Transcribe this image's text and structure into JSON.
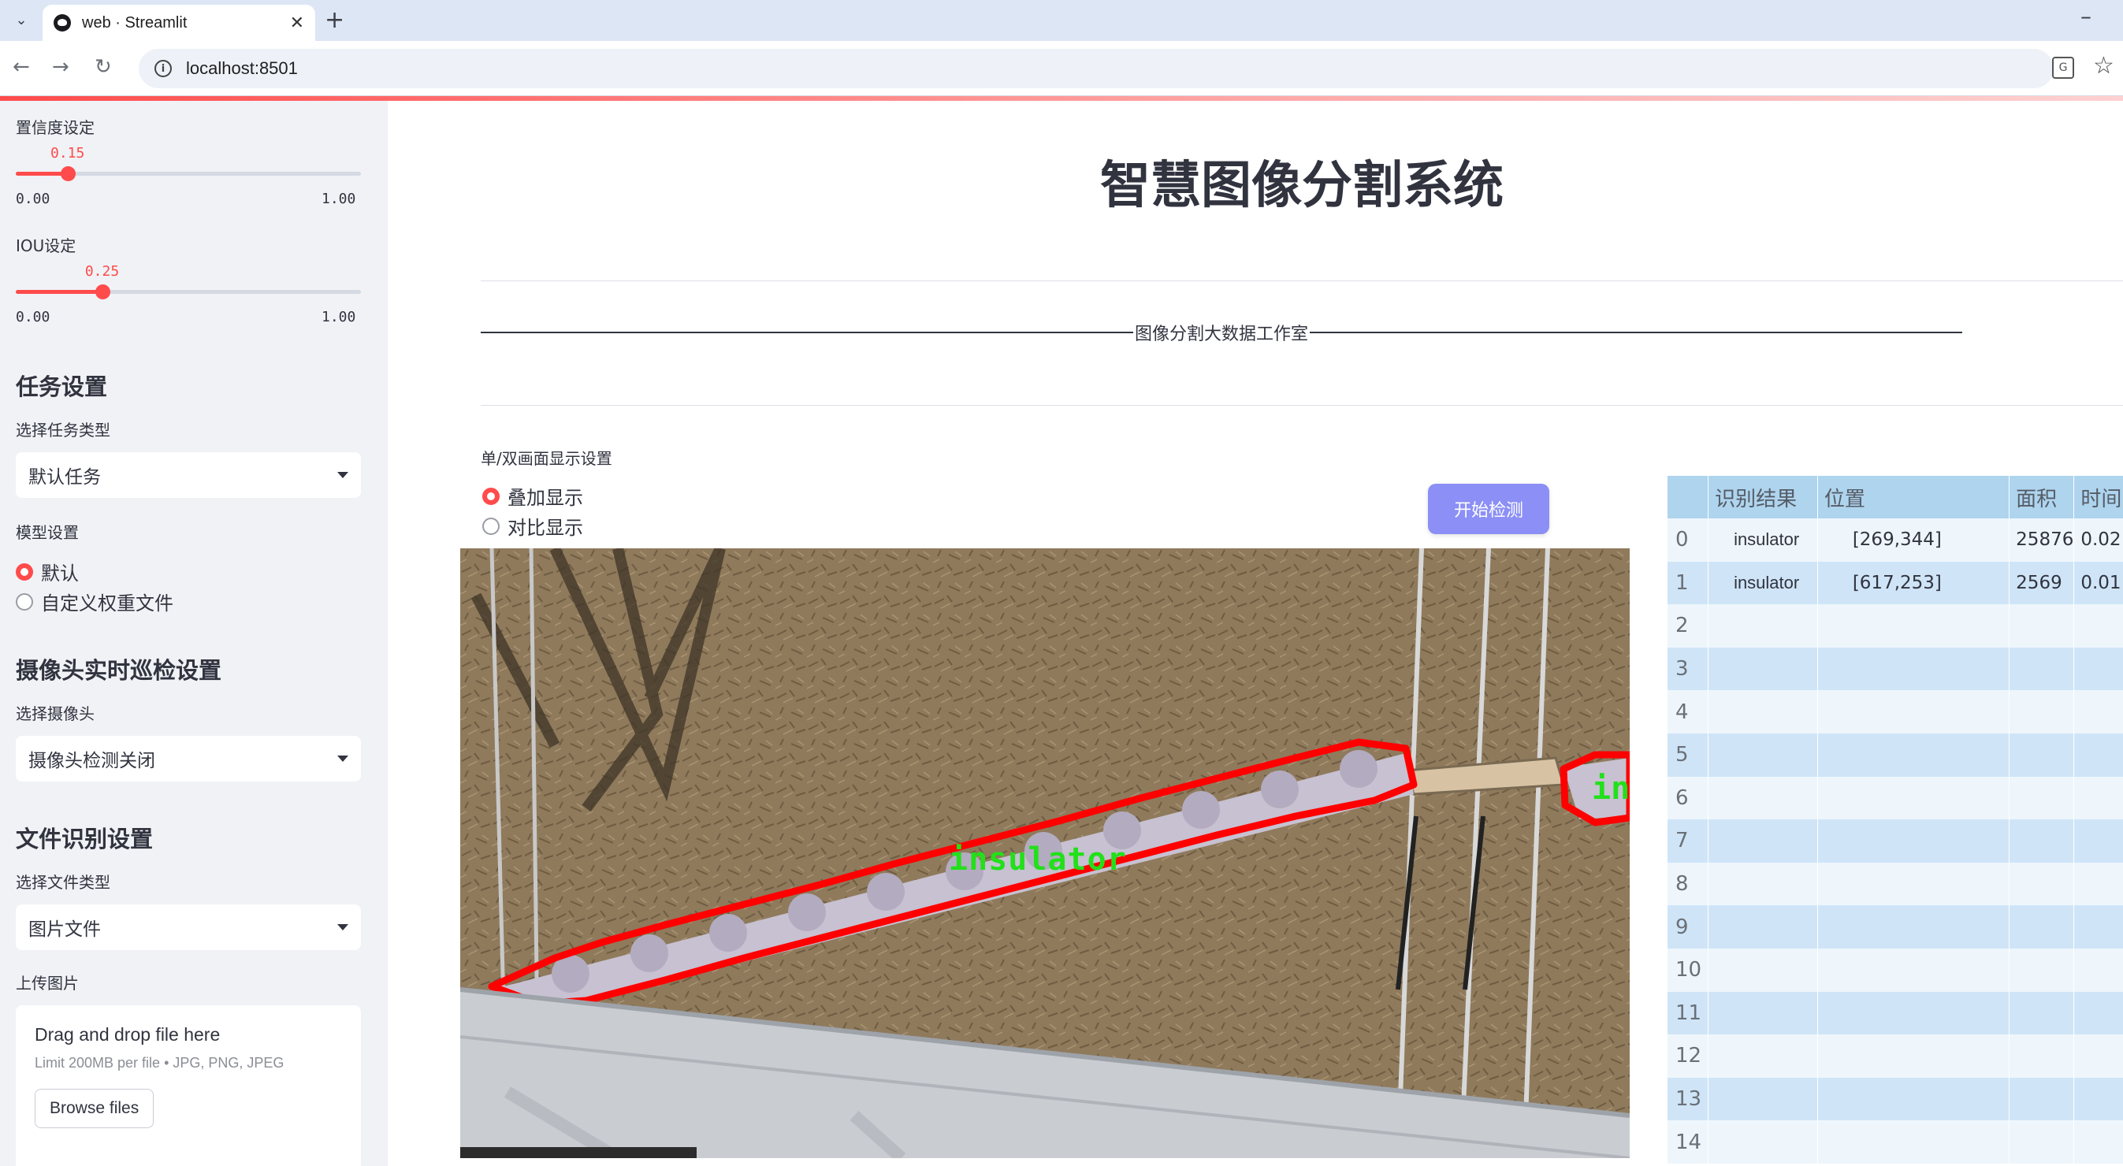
{
  "browser": {
    "tab_title": "web · Streamlit",
    "url": "localhost:8501"
  },
  "sidebar": {
    "confidence": {
      "label": "置信度设定",
      "value": "0.15",
      "min": "0.00",
      "max": "1.00",
      "fraction": 0.15
    },
    "iou": {
      "label": "IOU设定",
      "value": "0.25",
      "min": "0.00",
      "max": "1.00",
      "fraction": 0.25
    },
    "task_header": "任务设置",
    "task_type_label": "选择任务类型",
    "task_type_value": "默认任务",
    "model_label": "模型设置",
    "model_options": [
      "默认",
      "自定义权重文件"
    ],
    "model_selected": 0,
    "camera_header": "摄像头实时巡检设置",
    "camera_label": "选择摄像头",
    "camera_value": "摄像头检测关闭",
    "file_header": "文件识别设置",
    "file_type_label": "选择文件类型",
    "file_type_value": "图片文件",
    "upload_label": "上传图片",
    "upload_title": "Drag and drop file here",
    "upload_limit": "Limit 200MB per file • JPG, PNG, JPEG",
    "browse_label": "Browse files"
  },
  "main": {
    "title": "智慧图像分割系统",
    "studio": "图像分割大数据工作室",
    "display_label": "单/双画面显示设置",
    "display_options": [
      "叠加显示",
      "对比显示"
    ],
    "display_selected": 0,
    "start_button": "开始检测",
    "detection_label": "insulator",
    "detection_label_partial": "in"
  },
  "results": {
    "columns": [
      "",
      "识别结果",
      "位置",
      "面积",
      "时间"
    ],
    "rows": [
      [
        "0",
        "insulator",
        "[269,344]",
        "25876",
        "0.02"
      ],
      [
        "1",
        "insulator",
        "[617,253]",
        "2569",
        "0.01"
      ],
      [
        "2",
        "",
        "",
        "",
        ""
      ],
      [
        "3",
        "",
        "",
        "",
        ""
      ],
      [
        "4",
        "",
        "",
        "",
        ""
      ],
      [
        "5",
        "",
        "",
        "",
        ""
      ],
      [
        "6",
        "",
        "",
        "",
        ""
      ],
      [
        "7",
        "",
        "",
        "",
        ""
      ],
      [
        "8",
        "",
        "",
        "",
        ""
      ],
      [
        "9",
        "",
        "",
        "",
        ""
      ],
      [
        "10",
        "",
        "",
        "",
        ""
      ],
      [
        "11",
        "",
        "",
        "",
        ""
      ],
      [
        "12",
        "",
        "",
        "",
        ""
      ],
      [
        "13",
        "",
        "",
        "",
        ""
      ],
      [
        "14",
        "",
        "",
        "",
        ""
      ]
    ]
  },
  "colors": {
    "accent": "#ff4b4b",
    "button": "#8c8ff5",
    "table_header": "#aed4ee",
    "mask_outline": "#ff0000",
    "label_green": "#22e01a"
  }
}
